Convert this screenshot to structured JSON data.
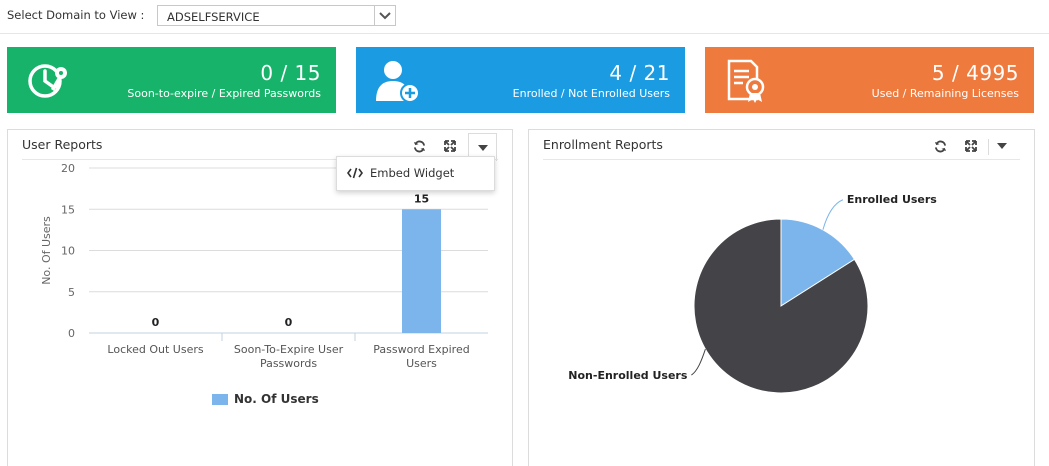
{
  "domain": {
    "label": "Select Domain to View :",
    "selected": "ADSELFSERVICE"
  },
  "cards": [
    {
      "value": "0 / 15",
      "caption": "Soon-to-expire / Expired Passwords",
      "color": "#18b36a",
      "icon": "clock-key-icon"
    },
    {
      "value": "4 / 21",
      "caption": "Enrolled / Not Enrolled Users",
      "color": "#1a9be2",
      "icon": "user-add-icon"
    },
    {
      "value": "5 / 4995",
      "caption": "Used / Remaining Licenses",
      "color": "#ee7a3e",
      "icon": "certificate-icon"
    }
  ],
  "user_reports": {
    "title": "User Reports",
    "menu": {
      "embed_label": "Embed Widget"
    }
  },
  "enrollment_reports": {
    "title": "Enrollment Reports"
  },
  "chart_data": [
    {
      "type": "bar",
      "categories": [
        "Locked Out Users",
        "Soon-To-Expire User Passwords",
        "Password Expired Users"
      ],
      "series": [
        {
          "name": "No. Of Users",
          "values": [
            0,
            0,
            15
          ],
          "color": "#7cb5ec"
        }
      ],
      "ylabel": "No. Of Users",
      "ylim": [
        0,
        20
      ],
      "yticks": [
        0,
        5,
        10,
        15,
        20
      ],
      "data_labels": [
        "0",
        "0",
        "15"
      ],
      "grid": true,
      "legend": "bottom"
    },
    {
      "type": "pie",
      "slices": [
        {
          "label": "Enrolled Users",
          "value": 4,
          "color": "#7cb5ec"
        },
        {
          "label": "Non-Enrolled Users",
          "value": 21,
          "color": "#434348"
        }
      ]
    }
  ]
}
